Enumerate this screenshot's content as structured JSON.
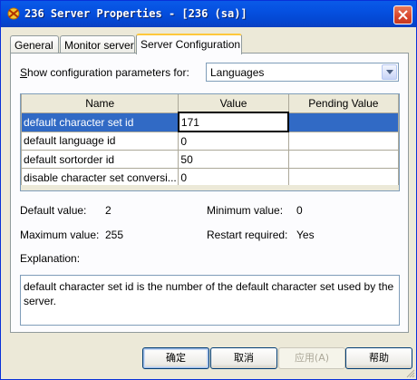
{
  "window": {
    "title": "236 Server Properties - [236 (sa)]"
  },
  "tabs": [
    {
      "label": "General"
    },
    {
      "label": "Monitor server"
    },
    {
      "label": "Server Configuration"
    }
  ],
  "config": {
    "show_label": "Show configuration parameters for:",
    "category_value": "Languages",
    "grid": {
      "headers": [
        "Name",
        "Value",
        "Pending Value"
      ],
      "rows": [
        {
          "name": "default character set id",
          "value": "171",
          "pending": ""
        },
        {
          "name": "default language id",
          "value": "0",
          "pending": ""
        },
        {
          "name": "default sortorder id",
          "value": "50",
          "pending": ""
        },
        {
          "name": "disable character set conversi...",
          "value": "0",
          "pending": ""
        }
      ]
    },
    "default_value_label": "Default value:",
    "default_value": "2",
    "minimum_value_label": "Minimum value:",
    "minimum_value": "0",
    "maximum_value_label": "Maximum value:",
    "maximum_value": "255",
    "restart_label": "Restart required:",
    "restart_value": "Yes",
    "explanation_label": "Explanation:",
    "explanation_text": "default character set id is the number of the default character set used by the server."
  },
  "buttons": {
    "ok": "确定",
    "cancel": "取消",
    "apply": "应用(A)",
    "help": "帮助"
  },
  "colors": {
    "titlebar": "#0550e0",
    "selection": "#316ac5",
    "active_tab_accent": "#ffc83c"
  }
}
